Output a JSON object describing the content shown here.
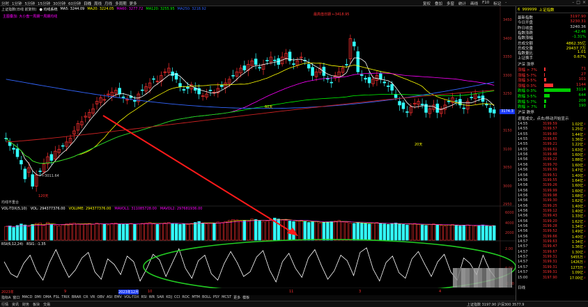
{
  "toolbar": {
    "periods": [
      "分时",
      "1分钟",
      "5分钟",
      "15分钟",
      "30分钟",
      "60分钟",
      "日线",
      "周线",
      "月线",
      "多周期",
      "更多"
    ],
    "active_period": "日线",
    "tools": [
      "复权",
      "叠加",
      "多窗",
      "统计",
      "画线",
      "F10",
      "标记",
      "-"
    ]
  },
  "main_chart": {
    "title": "上证指数(日线 前复权)",
    "legend": [
      {
        "label": "● 均线系统",
        "color": "#ffffff"
      },
      {
        "label": "MA5: 3244.09",
        "color": "#ffffff"
      },
      {
        "label": "MA20: 3224.05",
        "color": "#ffff00"
      },
      {
        "label": "MA60: 3277.72",
        "color": "#ff00ff"
      },
      {
        "label": "MA120: 3255.95",
        "color": "#00ff00"
      },
      {
        "label": "MA250: 3218.92",
        "color": "#3366ff"
      }
    ],
    "indicator_line": "主图叠加: 大小盘一周期一周期均线",
    "axis_labels": [
      "3450",
      "3400",
      "3350",
      "3300",
      "3250",
      "3200",
      "3150",
      "3100",
      "3050",
      "3000",
      "2950"
    ],
    "current_price_tag": "3174.3",
    "annotations": [
      {
        "text": "最高值日期 ←3418.95",
        "color": "#ff3030"
      },
      {
        "text": "←3011.64",
        "color": "#cccccc"
      },
      {
        "text": "120天",
        "color": "#ff3030"
      },
      {
        "text": "60天",
        "color": "#ffff00"
      },
      {
        "text": "20天",
        "color": "#ffff00"
      },
      {
        "text": "均线不重合",
        "color": "#cccccc"
      }
    ]
  },
  "volume": {
    "labels": [
      {
        "text": "VOL-TDX(5,10)",
        "color": "#ffffff"
      },
      {
        "text": "VOL: 294377376.00",
        "color": "#ffffff"
      },
      {
        "text": "VOLUME: 294377376.00",
        "color": "#ffff00"
      },
      {
        "text": "MAVOL1: 311085728.00",
        "color": "#ff00ff"
      },
      {
        "text": "MAVOL2: 297681936.00",
        "color": "#ff00ff"
      }
    ],
    "axis_labels": [
      "6000",
      "4000",
      "2000"
    ]
  },
  "rsi": {
    "labels": [
      {
        "text": "RSI(6,12,24)",
        "color": "#ffffff"
      },
      {
        "text": "RSI1: -1.35",
        "color": "#ffffff"
      }
    ],
    "axis_labels": [
      "2.00",
      "0.00",
      "-2.00"
    ]
  },
  "year_labels": [
    {
      "text": "2023年",
      "pos": 0
    },
    {
      "text": "9",
      "pos": 1
    },
    {
      "text": "10",
      "pos": 2
    },
    {
      "text": "2023年12月",
      "pos": 3
    },
    {
      "text": "11",
      "pos": 4
    },
    {
      "text": "3",
      "pos": 5
    },
    {
      "text": "4",
      "pos": 6
    }
  ],
  "indicator_tabs": [
    "指标A",
    "窗口",
    "MACD",
    "DMI",
    "DMA",
    "FSL",
    "TRIX",
    "BRAR",
    "CR",
    "VR",
    "OBV",
    "ASI",
    "EMV",
    "VOL-TDX",
    "RSI",
    "WR",
    "SAR",
    "KDJ",
    "CCI",
    "ROC",
    "MTM",
    "BOLL",
    "PSY",
    "MCST",
    "更多",
    "模板"
  ],
  "bottom_bar": {
    "left": [
      "行情",
      "资讯",
      "财务",
      "板块",
      "交易"
    ],
    "mid": "上证指数 3197.90 沪深300 3577.9"
  },
  "right_panel": {
    "code": "6",
    "symbol": "999999",
    "name": "上证指数",
    "stats": [
      {
        "label": "最新指数",
        "value": "3197.90",
        "color": "#ff3030"
      },
      {
        "label": "今日开盘",
        "value": "3230.31",
        "color": "#ff3030"
      },
      {
        "label": "昨日收盘",
        "value": "3240.36",
        "color": "#dddddd"
      },
      {
        "label": "指数涨跌",
        "value": "-42.46",
        "color": "#00ff00"
      },
      {
        "label": "指数涨幅",
        "value": "-1.31%",
        "color": "#00ff00"
      },
      {
        "label": "总成交额",
        "value": "4862.35亿",
        "color": "#ffff00"
      },
      {
        "label": "总成交量",
        "value": "29437.7万",
        "color": "#ffff00"
      },
      {
        "label": "指数量比",
        "value": "1.01",
        "color": "#ffff00"
      },
      {
        "label": "上证换手",
        "value": "0.67%",
        "color": "#ffff00"
      }
    ],
    "breadth_header": "沪深 涨停",
    "breadth": [
      {
        "label": "涨幅 > 7%",
        "value": "71",
        "color": "#ff3030",
        "bar": 0.05,
        "bar_color": "#ff3030"
      },
      {
        "label": "涨幅 5-7%",
        "value": "27",
        "color": "#ff3030",
        "bar": 0.03,
        "bar_color": "#ff3030"
      },
      {
        "label": "涨幅 3-5%",
        "value": "101",
        "color": "#ff3030",
        "bar": 0.07,
        "bar_color": "#ff3030"
      },
      {
        "label": "涨幅 0-3%",
        "value": "1144",
        "color": "#ff3030",
        "bar": 0.35,
        "bar_color": "#ff3030"
      },
      {
        "label": "跌幅 0-3%",
        "value": "3114",
        "color": "#00ff00",
        "bar": 1.0,
        "bar_color": "#00cc00"
      },
      {
        "label": "跌幅 3-5%",
        "value": "644",
        "color": "#00ff00",
        "bar": 0.22,
        "bar_color": "#00cc00"
      },
      {
        "label": "跌幅 5-7%",
        "value": "208",
        "color": "#00ff00",
        "bar": 0.07,
        "bar_color": "#00cc00"
      },
      {
        "label": "跌幅 > 7%",
        "value": "190",
        "color": "#00ff00",
        "bar": 0.06,
        "bar_color": "#00cc00"
      }
    ],
    "breadth_footer": "沪深 跌停",
    "tick_header": "逐笔成交，点击/移动开始显示",
    "ticks": [
      {
        "time": "14:55",
        "price": "3199.59",
        "vol": "1.02亿",
        "dir": "↓"
      },
      {
        "time": "14:55",
        "price": "3199.57",
        "vol": "1.25亿",
        "dir": "↓"
      },
      {
        "time": "14:55",
        "price": "3199.60",
        "vol": "1.44亿",
        "dir": "↓"
      },
      {
        "time": "14:55",
        "price": "3199.65",
        "vol": "1.36亿",
        "dir": "↓"
      },
      {
        "time": "14:55",
        "price": "3199.21",
        "vol": "1.22亿",
        "dir": "↓"
      },
      {
        "time": "14:55",
        "price": "3199.61",
        "vol": "1.63亿",
        "dir": "↓"
      },
      {
        "time": "14:56",
        "price": "3199.48",
        "vol": "1.60亿",
        "dir": "↓"
      },
      {
        "time": "14:56",
        "price": "3199.22",
        "vol": "1.88亿",
        "dir": "↓"
      },
      {
        "time": "14:56",
        "price": "3199.70",
        "vol": "1.60亿",
        "dir": "↓"
      },
      {
        "time": "14:56",
        "price": "3199.59",
        "vol": "1.47亿",
        "dir": "↓"
      },
      {
        "time": "14:56",
        "price": "3199.51",
        "vol": "1.40亿",
        "dir": "↓"
      },
      {
        "time": "14:56",
        "price": "3199.55",
        "vol": "1.64亿",
        "dir": "↓"
      },
      {
        "time": "14:56",
        "price": "3199.26",
        "vol": "1.60亿",
        "dir": "↓"
      },
      {
        "time": "14:56",
        "price": "3199.99",
        "vol": "1.60亿",
        "dir": "↓"
      },
      {
        "time": "14:56",
        "price": "3199.98",
        "vol": "1.68亿",
        "dir": "↓"
      },
      {
        "time": "14:56",
        "price": "3199.30",
        "vol": "1.62亿",
        "dir": "↓"
      },
      {
        "time": "14:56",
        "price": "3199.25",
        "vol": "1.40亿",
        "dir": "↓"
      },
      {
        "time": "14:56",
        "price": "3199.12",
        "vol": "1.40亿",
        "dir": "↓"
      },
      {
        "time": "14:56",
        "price": "3199.43",
        "vol": "1.33亿",
        "dir": "↓"
      },
      {
        "time": "14:56",
        "price": "3199.20",
        "vol": "1.62亿",
        "dir": "↓"
      },
      {
        "time": "14:56",
        "price": "3199.28",
        "vol": "1.34亿",
        "dir": "↓"
      },
      {
        "time": "14:56",
        "price": "3199.52",
        "vol": "1.49亿",
        "dir": "↓"
      },
      {
        "time": "14:56",
        "price": "3199.66",
        "vol": "1.40亿",
        "dir": "↓"
      },
      {
        "time": "14:57",
        "price": "3199.63",
        "vol": "1.34亿",
        "dir": "↓"
      },
      {
        "time": "14:57",
        "price": "3199.47",
        "vol": "1.36亿",
        "dir": "↓"
      },
      {
        "time": "14:57",
        "price": "3199.67",
        "vol": "1.30亿",
        "dir": "↓"
      },
      {
        "time": "14:57",
        "price": "3199.31",
        "vol": "5455万",
        "dir": "↓"
      },
      {
        "time": "14:57",
        "price": "3199.31",
        "vol": "1426万",
        "dir": "↓"
      },
      {
        "time": "14:57",
        "price": "3199.31",
        "vol": "1273万",
        "dir": "↓"
      },
      {
        "time": "14:57",
        "price": "3199.31",
        "vol": "1.09亿",
        "dir": "↓"
      },
      {
        "time": "15:00",
        "price": "3197.90",
        "vol": "17.00亿",
        "dir": "↓"
      }
    ],
    "footer": "日线"
  },
  "chart_data": {
    "type": "candlestick",
    "title": "上证指数(日线 前复权)",
    "ylim": [
      2950,
      3450
    ],
    "closes": [
      3130,
      3110,
      3100,
      3080,
      3060,
      3020,
      3050,
      3000,
      3030,
      3040,
      3060,
      3080,
      3070,
      3095,
      3100,
      3110,
      3120,
      3130,
      3150,
      3170,
      3175,
      3190,
      3200,
      3210,
      3230,
      3240,
      3235,
      3250,
      3255,
      3260,
      3250,
      3240,
      3235,
      3240,
      3230,
      3250,
      3260,
      3270,
      3280,
      3290,
      3285,
      3300,
      3310,
      3320,
      3300,
      3290,
      3270,
      3260,
      3265,
      3275,
      3260,
      3250,
      3245,
      3250,
      3260,
      3255,
      3265,
      3270,
      3280,
      3290,
      3300,
      3310,
      3320,
      3315,
      3330,
      3340,
      3330,
      3320,
      3330,
      3340,
      3350,
      3340,
      3330,
      3350,
      3360,
      3340,
      3330,
      3340,
      3350,
      3340,
      3320,
      3300,
      3310,
      3320,
      3300,
      3290,
      3280,
      3300,
      3310,
      3320,
      3330,
      3400,
      3380,
      3310,
      3300,
      3290,
      3280,
      3290,
      3300,
      3290,
      3280,
      3270,
      3260,
      3240,
      3220,
      3210,
      3200,
      3215,
      3225,
      3230,
      3220,
      3200,
      3210,
      3220,
      3200,
      3210,
      3220,
      3230,
      3240,
      3230,
      3220,
      3210,
      3230,
      3240,
      3250,
      3240,
      3230,
      3220,
      3200,
      3197.9
    ],
    "volumes": [
      2800,
      2900,
      2600,
      3000,
      3300,
      3100,
      2800,
      3200,
      3400,
      3500,
      3000,
      3600,
      3200,
      3000,
      2900,
      3100,
      3300,
      3400,
      3500,
      3300,
      3200,
      3300,
      3400,
      3200,
      3500,
      3300,
      3200,
      3100,
      3400,
      3500,
      3300,
      3200,
      3300,
      3400,
      3200,
      3300,
      3400,
      3500,
      3600,
      3300,
      3200,
      3400,
      3500,
      3600,
      3400,
      3300,
      3200,
      3300,
      3200,
      3400,
      3600,
      3800,
      3500,
      3300,
      3400,
      3500,
      3700,
      3600,
      3800,
      4000,
      4200,
      4100,
      3900,
      4000,
      3800,
      4300,
      4200,
      4000,
      3800,
      3900,
      4200,
      4500,
      4300,
      4100,
      4000,
      3900,
      3800,
      3900,
      4000,
      3800,
      3600,
      3700,
      3800,
      3500,
      3600,
      3700,
      3800,
      3900,
      4000,
      3700,
      3600,
      3500,
      3400,
      3600,
      3500,
      3400,
      3300,
      3500,
      3600,
      3400,
      3300,
      3200,
      3400,
      3500,
      3300,
      3200,
      3100,
      3300,
      3400,
      3200,
      3100,
      3000,
      3200,
      3300,
      3100,
      3000,
      2900,
      3100,
      3200,
      3000,
      2900,
      3000,
      3100,
      3000,
      2900,
      3000,
      3100,
      2900,
      2800,
      2944
    ],
    "rsi": [
      0.5,
      -0.8,
      -1.2,
      0.3,
      1.2,
      -0.5,
      -1.5,
      0.4,
      1.8,
      0.2,
      -1.2,
      -0.4,
      0.9,
      1.5,
      -0.6,
      -1.4,
      0.8,
      0.2,
      -0.9,
      1.1,
      0.5,
      -1.6,
      -0.3,
      1.3,
      0.7,
      -1.1,
      0.4,
      1.9,
      -0.2,
      -1.3,
      0.6,
      1.2,
      -0.8,
      -1.5,
      0.3,
      1.6,
      0.4,
      -1.1,
      -0.6,
      1.0,
      1.7,
      -0.4,
      -1.7,
      0.5,
      1.4,
      -0.2,
      -1.2,
      0.9,
      1.8,
      0.1,
      -1.4,
      -0.5,
      1.2,
      0.6,
      -1.0,
      1.5,
      2.0,
      -0.3,
      -1.6,
      0.4,
      1.1,
      -0.7,
      -1.3,
      0.8,
      1.6,
      0.2,
      -1.1,
      0.5,
      1.3,
      -0.6,
      -1.5,
      0.9,
      0.3,
      -0.9,
      1.2,
      -0.4,
      -1.35
    ]
  }
}
